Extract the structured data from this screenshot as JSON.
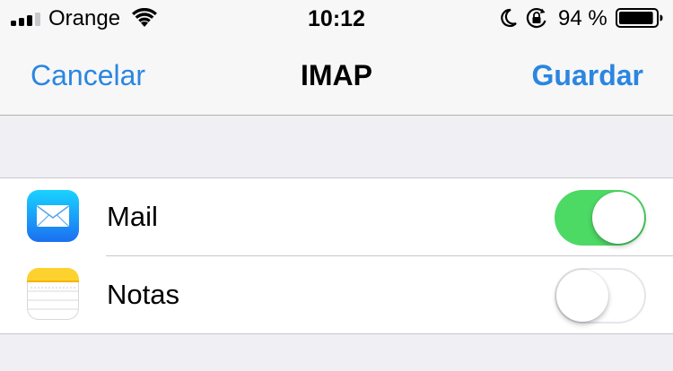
{
  "status_bar": {
    "carrier": "Orange",
    "time": "10:12",
    "battery_percent": "94 %",
    "signal_bars": 3,
    "signal_bars_total": 4,
    "battery_level": 0.94,
    "icons": [
      "signal-icon",
      "wifi-icon",
      "moon-icon",
      "orientation-lock-icon",
      "battery-icon"
    ]
  },
  "nav": {
    "cancel_label": "Cancelar",
    "title": "IMAP",
    "save_label": "Guardar"
  },
  "settings": {
    "items": [
      {
        "label": "Mail",
        "icon": "mail-icon",
        "enabled": true
      },
      {
        "label": "Notas",
        "icon": "notes-icon",
        "enabled": false
      }
    ]
  },
  "colors": {
    "accent": "#2b86e0",
    "toggle_on": "#4cd964",
    "background": "#efeff4"
  }
}
